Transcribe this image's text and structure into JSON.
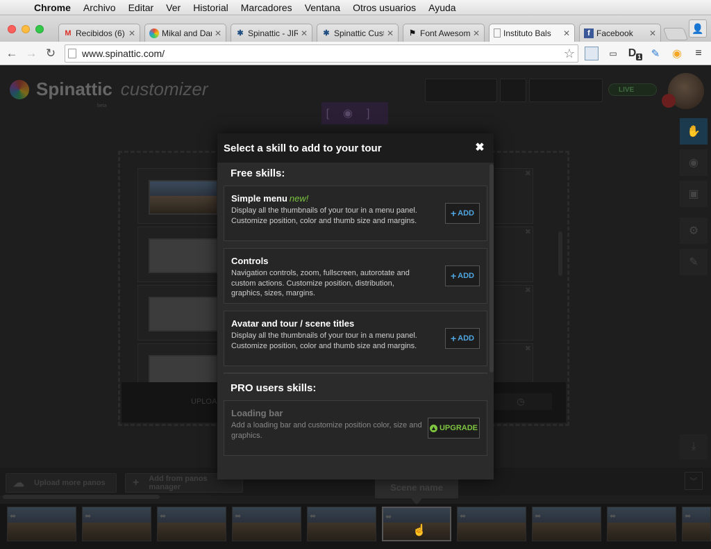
{
  "os_menu": {
    "apple": "",
    "items": [
      "Chrome",
      "Archivo",
      "Editar",
      "Ver",
      "Historial",
      "Marcadores",
      "Ventana",
      "Otros usuarios",
      "Ayuda"
    ]
  },
  "browser": {
    "tabs": [
      {
        "label": "Recibidos (6)",
        "icon": "gmail-icon"
      },
      {
        "label": "Mikal and Dar",
        "icon": "pinwheel-icon"
      },
      {
        "label": "Spinattic - JIR",
        "icon": "jira-icon"
      },
      {
        "label": "Spinattic Cust",
        "icon": "jira-icon"
      },
      {
        "label": "Font Awesom",
        "icon": "flag-icon"
      },
      {
        "label": "Instituto Bals",
        "icon": "page-icon"
      },
      {
        "label": "Facebook",
        "icon": "facebook-icon"
      }
    ],
    "url": "www.spinattic.com/",
    "extensions": {
      "d_badge": "1"
    }
  },
  "app": {
    "brand": "Spinattic",
    "brand_sub": "customizer",
    "brand_tag": "beta",
    "live_label": "LIVE"
  },
  "bottom": {
    "upload_more": "Upload more panos",
    "add_from": "Add from panos manager",
    "scene_name": "Scene name",
    "upload_strip": "UPLOA"
  },
  "modal": {
    "title": "Select a skill to add to your tour",
    "close": "✖",
    "free_label": "Free skills:",
    "pro_label": "PRO users skills:",
    "free_skills": [
      {
        "name": "Simple menu",
        "badge": "new!",
        "desc": "Display all the thumbnails of your tour in a menu panel. Customize position, color and thumb size and margins.",
        "action": "ADD"
      },
      {
        "name": "Controls",
        "badge": "",
        "desc": "Navigation controls, zoom, fullscreen, autorotate and custom actions. Customize position, distribution, graphics, sizes, margins.",
        "action": "ADD"
      },
      {
        "name": "Avatar and tour / scene titles",
        "badge": "",
        "desc": "Display all the thumbnails of your tour in a menu panel. Customize position, color and thumb size and margins.",
        "action": "ADD"
      }
    ],
    "pro_skills": [
      {
        "name": "Loading bar",
        "desc": "Add a loading bar and customize position color, size and graphics.",
        "action": "UPGRADE"
      }
    ]
  },
  "colors": {
    "accent_blue": "#4fa6e0",
    "accent_green": "#7ec540"
  }
}
